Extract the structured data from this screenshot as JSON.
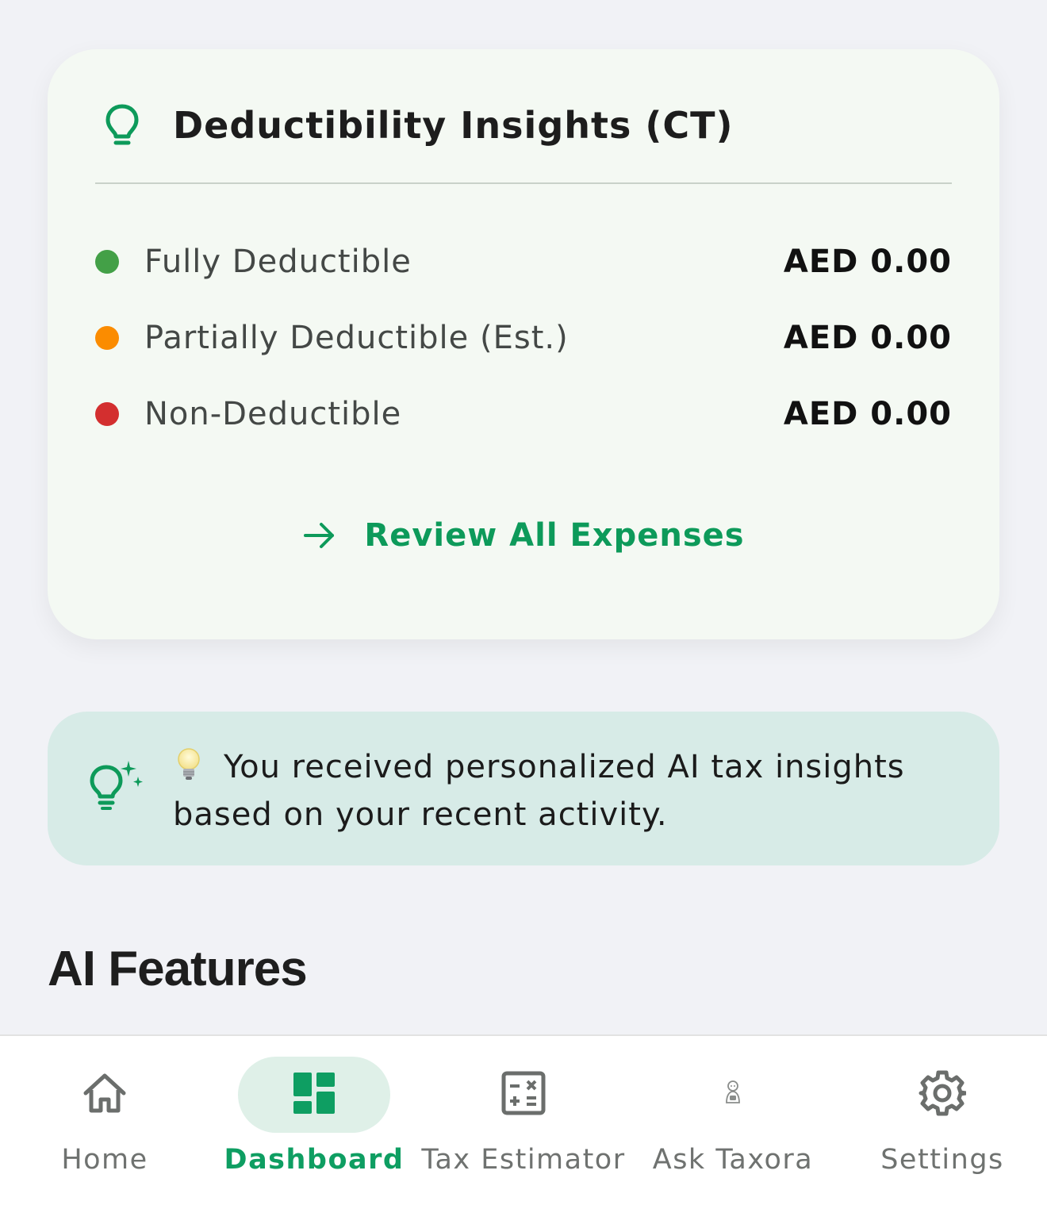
{
  "insights_card": {
    "title": "Deductibility Insights (CT)",
    "rows": [
      {
        "label": "Fully Deductible",
        "value": "AED 0.00",
        "color": "#43a047"
      },
      {
        "label": "Partially Deductible (Est.)",
        "value": "AED 0.00",
        "color": "#fb8c00"
      },
      {
        "label": "Non-Deductible",
        "value": "AED 0.00",
        "color": "#d32f2f"
      }
    ],
    "review_label": "Review All Expenses",
    "accent": "#0d9a5a"
  },
  "ai_banner": {
    "text": "You received personalized AI tax insights based on your recent activity.",
    "icon": "lightbulb-sparkle-icon",
    "background": "#d7ebe7"
  },
  "section": {
    "title": "AI Features"
  },
  "bottom_nav": {
    "items": [
      {
        "label": "Home",
        "icon": "home-icon",
        "active": false
      },
      {
        "label": "Dashboard",
        "icon": "dashboard-icon",
        "active": true
      },
      {
        "label": "Tax Estimator",
        "icon": "calculator-icon",
        "active": false
      },
      {
        "label": "Ask Taxora",
        "icon": "assistant-icon",
        "active": false
      },
      {
        "label": "Settings",
        "icon": "gear-icon",
        "active": false
      }
    ],
    "active_color": "#0e9e62"
  }
}
